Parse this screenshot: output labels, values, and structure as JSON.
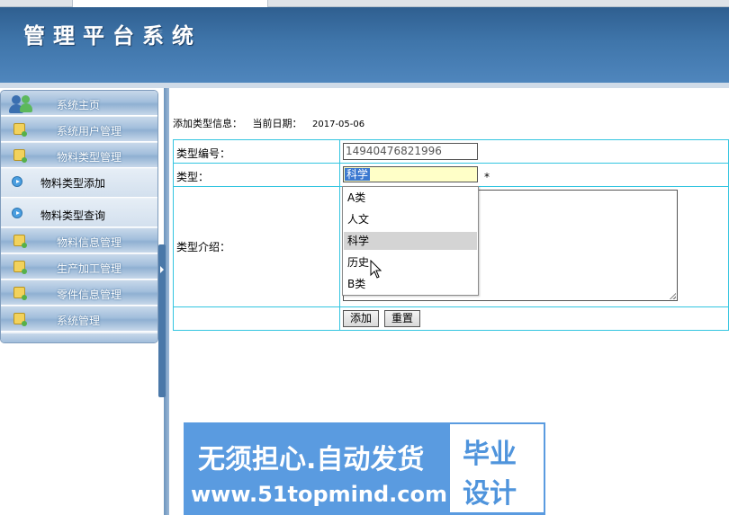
{
  "header": {
    "title": "管理平台系统"
  },
  "sidebar": {
    "items": [
      {
        "label": "系统主页",
        "icon": "users-icon"
      },
      {
        "label": "系统用户管理",
        "icon": "folder-icon"
      },
      {
        "label": "物料类型管理",
        "icon": "folder-icon"
      },
      {
        "label": "物料类型添加",
        "icon": "arrow-icon"
      },
      {
        "label": "物料类型查询",
        "icon": "arrow-icon"
      },
      {
        "label": "物料信息管理",
        "icon": "folder-icon"
      },
      {
        "label": "生产加工管理",
        "icon": "folder-icon"
      },
      {
        "label": "零件信息管理",
        "icon": "folder-icon"
      },
      {
        "label": "系统管理",
        "icon": "folder-icon"
      }
    ]
  },
  "info": {
    "label": "添加类型信息：",
    "date_label": "当前日期：",
    "date": "2017-05-06"
  },
  "form": {
    "code_label": "类型编号：",
    "code_value": "14940476821996",
    "type_label": "类型：",
    "type_value": "科学",
    "required_mark": "*",
    "intro_label": "类型介绍：",
    "add_button": "添加",
    "reset_button": "重置"
  },
  "dropdown": {
    "options": [
      "A类",
      "人文",
      "科学",
      "历史",
      "B类"
    ],
    "selected_index": 2
  },
  "ad": {
    "line1": "无须担心.自动发货",
    "line2": "www.51topmind.com",
    "badge_top": "毕业",
    "badge_bottom": "设计"
  },
  "colors": {
    "header": "#3f75aa",
    "border": "#33c5e0",
    "select_highlight": "#3a78d0",
    "ad_bg": "#5a9be0"
  }
}
